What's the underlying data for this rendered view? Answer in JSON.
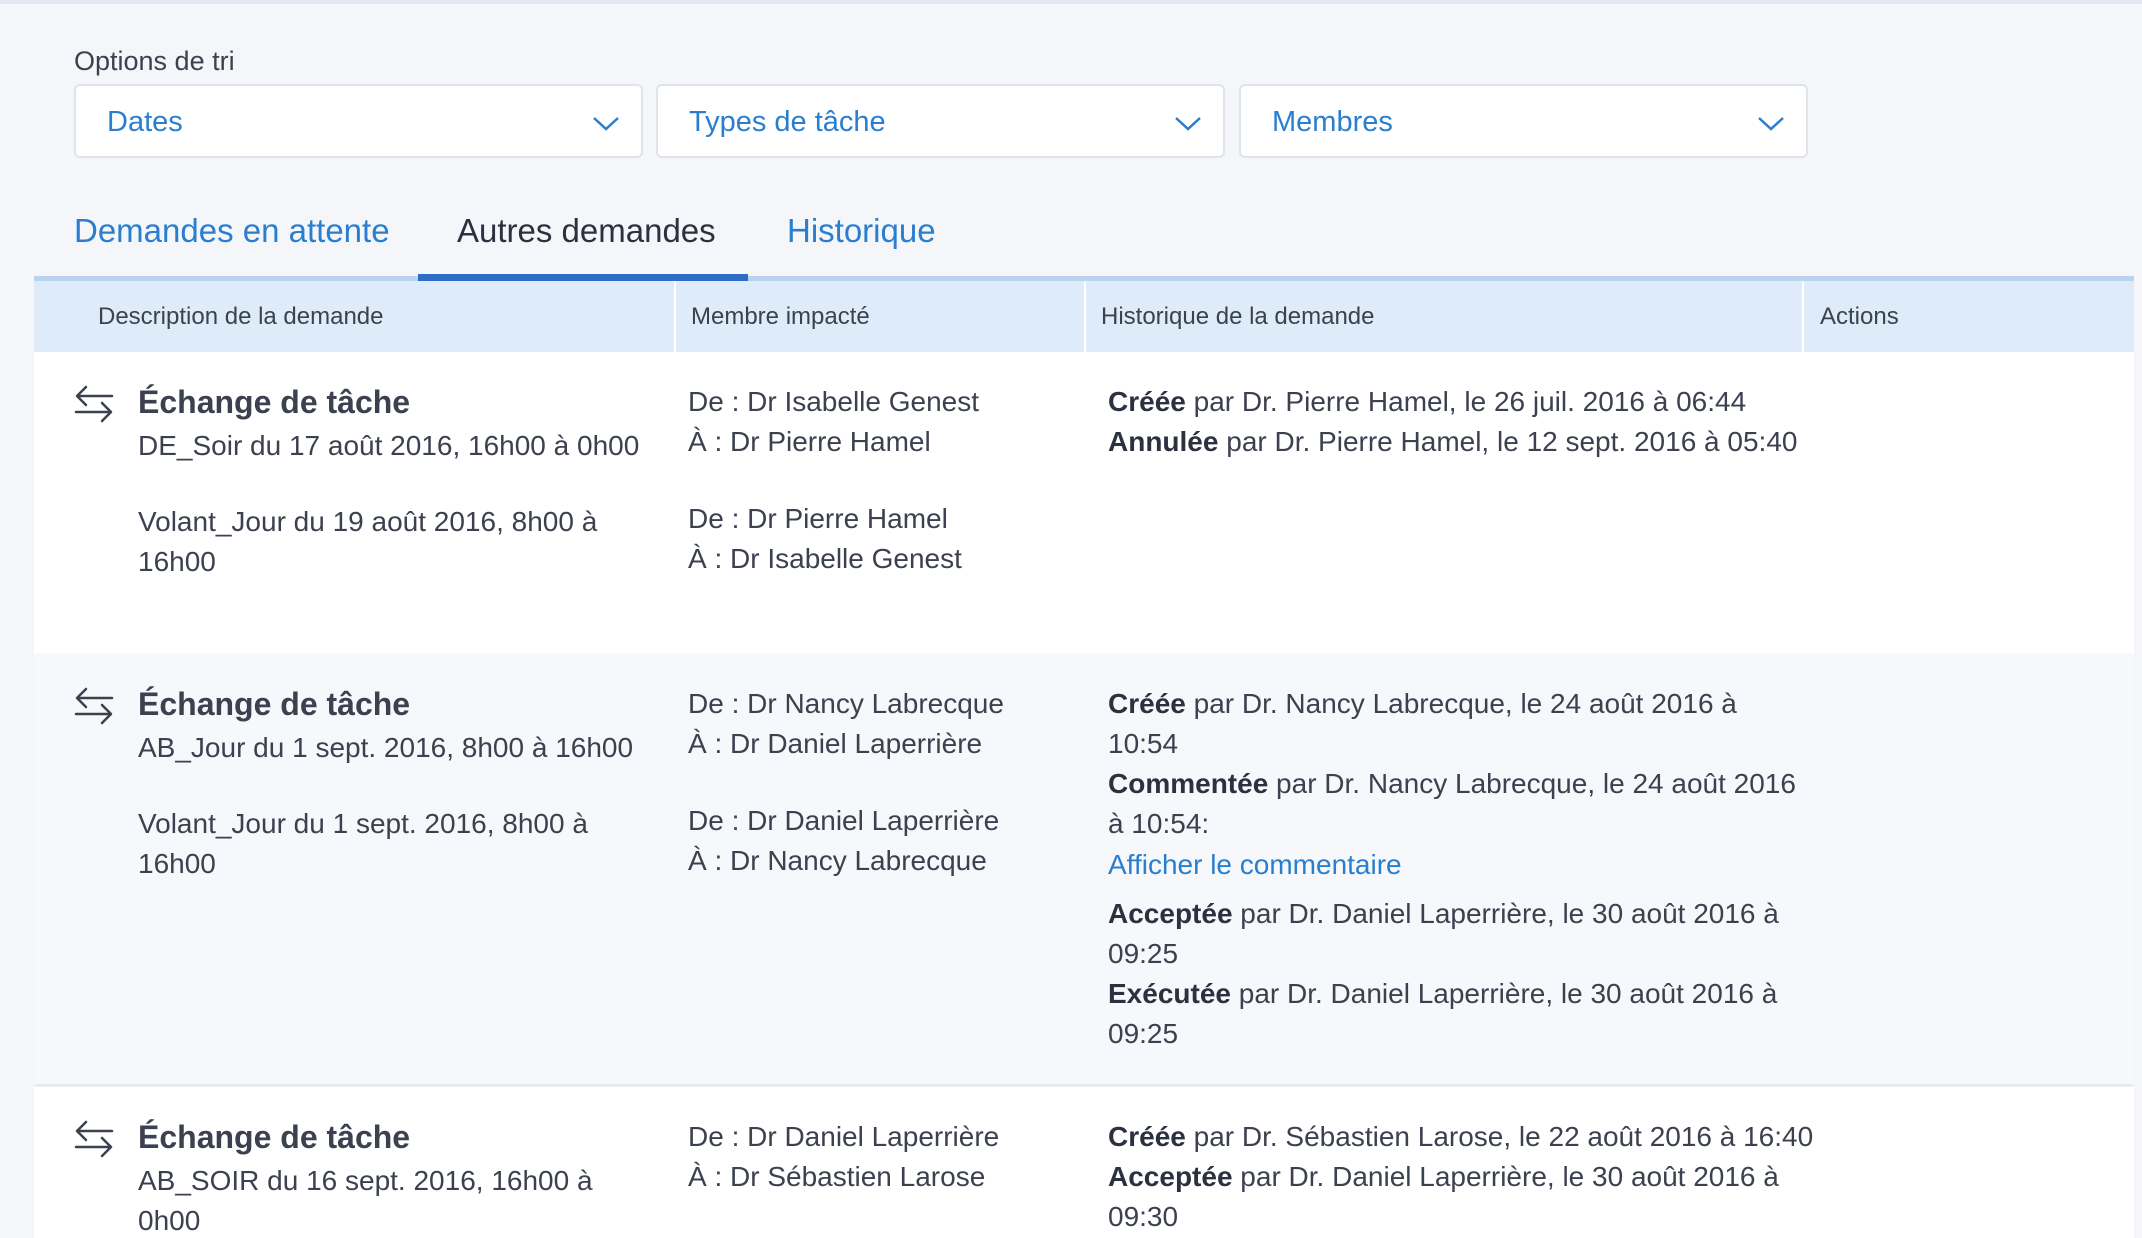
{
  "sort": {
    "label": "Options de tri",
    "selects": [
      {
        "value": "Dates"
      },
      {
        "value": "Types de tâche"
      },
      {
        "value": "Membres"
      }
    ]
  },
  "tabs": [
    {
      "label": "Demandes en attente",
      "active": false
    },
    {
      "label": "Autres demandes",
      "active": true
    },
    {
      "label": "Historique",
      "active": false
    }
  ],
  "table": {
    "headers": [
      "Description de la demande",
      "Membre impacté",
      "Historique de la demande",
      "Actions"
    ],
    "rows": [
      {
        "type": "Échange de tâche",
        "desc": [
          "DE_Soir du 17 août 2016, 16h00 à 0h00",
          "Volant_Jour du 19 août 2016, 8h00 à",
          "16h00"
        ],
        "members": [
          "De : Dr Isabelle Genest",
          "À : Dr Pierre Hamel",
          "De : Dr Pierre Hamel",
          "À : Dr Isabelle Genest"
        ],
        "history": [
          {
            "action": "Créée",
            "text": " par Dr. Pierre Hamel, le 26 juil. 2016 à 06:44"
          },
          {
            "action": "Annulée",
            "text": " par Dr. Pierre Hamel, le 12 sept. 2016 à 05:40"
          }
        ]
      },
      {
        "type": "Échange de tâche",
        "desc": [
          "AB_Jour du 1 sept. 2016, 8h00 à 16h00",
          "Volant_Jour du 1 sept. 2016, 8h00 à",
          "16h00"
        ],
        "members": [
          "De : Dr Nancy Labrecque",
          "À : Dr Daniel Laperrière",
          "De : Dr Daniel Laperrière",
          "À : Dr Nancy Labrecque"
        ],
        "history": [
          {
            "action": "Créée",
            "text": " par Dr. Nancy Labrecque, le 24 août 2016 à",
            "cont": "10:54"
          },
          {
            "action": "Commentée",
            "text": " par Dr. Nancy Labrecque, le 24 août 2016",
            "cont": "à 10:54:"
          },
          {
            "action": "Acceptée",
            "text": " par Dr. Daniel Laperrière, le 30 août 2016 à",
            "cont": "09:25"
          },
          {
            "action": "Exécutée",
            "text": " par Dr. Daniel Laperrière, le 30 août 2016 à",
            "cont": "09:25"
          }
        ],
        "comment_link": "Afficher le commentaire"
      },
      {
        "type": "Échange de tâche",
        "desc": [
          "AB_SOIR du 16 sept. 2016, 16h00 à",
          "0h00"
        ],
        "members": [
          "De : Dr Daniel Laperrière",
          "À : Dr Sébastien Larose"
        ],
        "history": [
          {
            "action": "Créée",
            "text": " par Dr. Sébastien Larose, le 22 août 2016 à 16:40"
          },
          {
            "action": "Acceptée",
            "text": " par Dr. Daniel Laperrière, le 30 août 2016 à",
            "cont": "09:30"
          }
        ]
      }
    ]
  },
  "icons": {
    "swap": "swap-arrows-icon",
    "chevron": "chevron-down-icon"
  },
  "colors": {
    "accent": "#2a7ed0",
    "header_bg": "#deecf9",
    "tab_underline": "#2f6cc7"
  }
}
